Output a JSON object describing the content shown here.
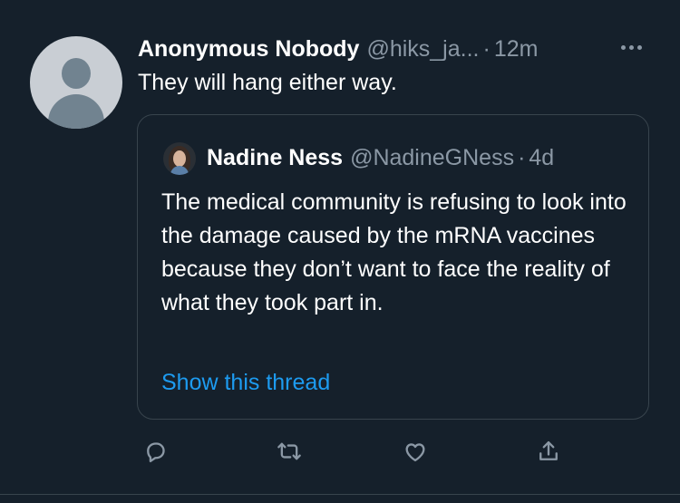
{
  "tweet": {
    "author_name": "Anonymous Nobody",
    "author_handle": "@hiks_ja...",
    "separator": "·",
    "time": "12m",
    "text": "They will hang either way."
  },
  "quoted_tweet": {
    "author_name": "Nadine Ness",
    "author_handle": "@NadineGNess",
    "separator": "·",
    "time": "4d",
    "text": "The medical community is refusing to look into the damage caused by the mRNA vaccines because they don’t want to face the reality of what they took part in.",
    "show_thread": "Show this thread"
  },
  "actions": [
    "reply-icon",
    "retweet-icon",
    "like-icon",
    "share-icon"
  ],
  "colors": {
    "background": "#15202b",
    "secondary_text": "#8b98a5",
    "link": "#1d9bf0",
    "border": "#38444d"
  }
}
